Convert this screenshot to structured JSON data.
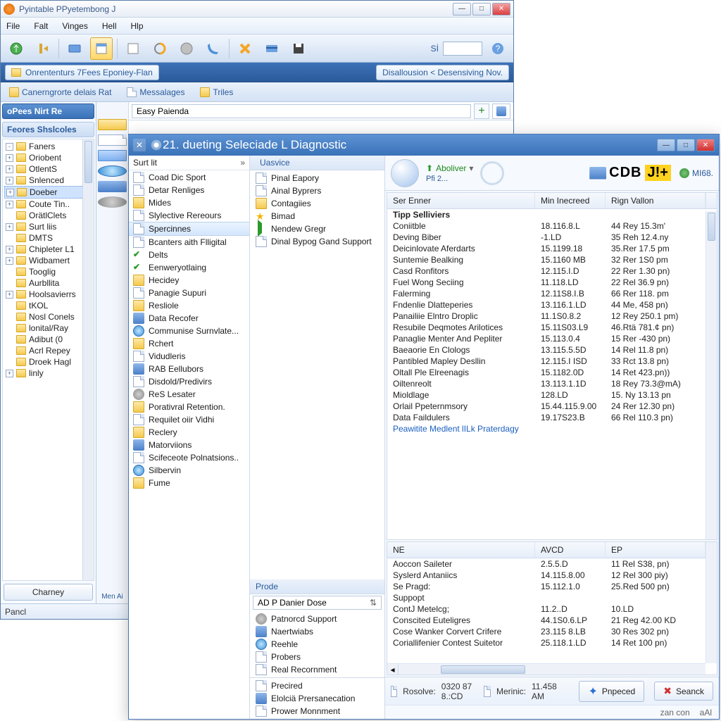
{
  "main": {
    "title": "Pyintable PPyetembong J",
    "menus": [
      "File",
      "Falt",
      "Vinges",
      "Hell",
      "Hlp"
    ],
    "breadcrumb": "Onrententurs 7Fees Eponiey-Flan",
    "infoRight": "Disallousion < Desensiving Nov.",
    "tabs": [
      "Canerngrorte delais Rat",
      "Messalages",
      "Triles"
    ],
    "locValue": "Easy Paienda",
    "sidebar": {
      "topLabel": "oPees Nirt Re",
      "header": "Feores Shslcoles",
      "items": [
        {
          "label": "Faners",
          "exp": "-"
        },
        {
          "label": "Oriobent",
          "exp": "+"
        },
        {
          "label": "OtlentS",
          "exp": "+"
        },
        {
          "label": "Snlenced",
          "exp": "+"
        },
        {
          "label": "Doeber",
          "exp": "+",
          "sel": true
        },
        {
          "label": "Coute Tin..",
          "exp": "+"
        },
        {
          "label": "OrätlClets",
          "exp": ""
        },
        {
          "label": "Surt liis",
          "exp": "+"
        },
        {
          "label": "DMTS",
          "exp": ""
        },
        {
          "label": "Chipleter L1",
          "exp": "+"
        },
        {
          "label": "Widbamert",
          "exp": "+"
        },
        {
          "label": "Tooglig",
          "exp": ""
        },
        {
          "label": "Aurbllita",
          "exp": ""
        },
        {
          "label": "Hoolsavierrs",
          "exp": "+"
        },
        {
          "label": "tKOL",
          "exp": ""
        },
        {
          "label": "Nosl Conels",
          "exp": ""
        },
        {
          "label": "lonital/Ray",
          "exp": ""
        },
        {
          "label": "Adibut (0",
          "exp": ""
        },
        {
          "label": "Acrl Repey",
          "exp": ""
        },
        {
          "label": "Droek Hagl",
          "exp": ""
        },
        {
          "label": "linly",
          "exp": "+"
        }
      ],
      "button": "Charney",
      "status": "Pancl"
    },
    "leftStrip": {
      "bottom": "Men Ai"
    }
  },
  "diag": {
    "title": "21. dueting Seleciade L Diagnostic",
    "sidebar": {
      "headLabel": "Surt lit",
      "items": [
        {
          "label": "Coad Dic Sport",
          "icon": "doc"
        },
        {
          "label": "Detar Renliges",
          "icon": "doc"
        },
        {
          "label": "Mides",
          "icon": "folder"
        },
        {
          "label": "Slylective Rereours",
          "icon": "doc"
        },
        {
          "label": "Spercinnes",
          "icon": "doc",
          "sel": true
        },
        {
          "label": "Bcanters aith Flligital",
          "icon": "doc"
        },
        {
          "label": "Delts",
          "icon": "check"
        },
        {
          "label": "Eenweryotlaing",
          "icon": "check"
        },
        {
          "label": "Hecidey",
          "icon": "folder"
        },
        {
          "label": "Panagie Supuri",
          "icon": "doc"
        },
        {
          "label": "Resliole",
          "icon": "folder"
        },
        {
          "label": "Data Recofer",
          "icon": "bluesq"
        },
        {
          "label": "Communise Surnvlate...",
          "icon": "globe"
        },
        {
          "label": "Rchert",
          "icon": "folder"
        },
        {
          "label": "Vidudleris",
          "icon": "doc"
        },
        {
          "label": "RAB Eellubors",
          "icon": "bluesq"
        },
        {
          "label": "Disdold/Predivirs",
          "icon": "doc"
        },
        {
          "label": "ReS Lesater",
          "icon": "gear"
        },
        {
          "label": "Porativral Retention.",
          "icon": "folder"
        },
        {
          "label": "Requilet oiir Vidhi",
          "icon": "doc"
        },
        {
          "label": "Reclery",
          "icon": "folder"
        },
        {
          "label": "Matorviions",
          "icon": "bluesq"
        },
        {
          "label": "Scifeceote Polnatsions..",
          "icon": "doc"
        },
        {
          "label": "Silbervin",
          "icon": "globe"
        },
        {
          "label": "Fume",
          "icon": "folder"
        }
      ]
    },
    "mid": {
      "topHead": "Uasvice",
      "topItems": [
        {
          "label": "Pinal Eapory",
          "icon": "doc"
        },
        {
          "label": "Ainal Byprers",
          "icon": "doc"
        },
        {
          "label": "Contagiies",
          "icon": "folder"
        },
        {
          "label": "Bimad",
          "icon": "star"
        },
        {
          "label": "Nendew Gregr",
          "icon": "arrow"
        },
        {
          "label": "Dinal Bypog Gand Support",
          "icon": "doc"
        }
      ],
      "prodeHead": "Prode",
      "dropLabel": "AD P Danier Dose",
      "prodeItems": [
        {
          "label": "Patnorcd Support",
          "icon": "gear"
        },
        {
          "label": "Naertwiabs",
          "icon": "bluesq"
        },
        {
          "label": "Reehle",
          "icon": "globe"
        },
        {
          "label": "Probers",
          "icon": "doc"
        },
        {
          "label": "Real Recornment",
          "icon": "doc"
        }
      ],
      "bottomItems": [
        {
          "label": "Precired",
          "icon": "doc"
        },
        {
          "label": "Elolciä Prersanecation",
          "icon": "bluesq"
        },
        {
          "label": "Prower Monnment",
          "icon": "doc"
        }
      ]
    },
    "toolbar": {
      "aboliver": "Aboliver",
      "pfi": "Pfi 2...",
      "brand": "CDB",
      "jplus": "J!+",
      "mi": "MI68."
    },
    "grid1": {
      "headers": [
        "Ser Enner",
        "Min Inecreed",
        "Rign Vallon"
      ],
      "rows": [
        {
          "c1": "Tipp Selliviers",
          "c2": "",
          "c3": "",
          "hdr": true
        },
        {
          "c1": "Coniitble",
          "c2": "18.116.8.L",
          "c3": "44 Rey 15.3m'"
        },
        {
          "c1": "Deving Biber",
          "c2": "-1.LD",
          "c3": "35 Reh 12.4.ny"
        },
        {
          "c1": "Deicinlovate Aferdarts",
          "c2": "15.1199.18",
          "c3": "35.Rer 17.5 pm"
        },
        {
          "c1": "Suntemie Bealking",
          "c2": "15.1160 MB",
          "c3": "32 Rer 1S0 pm"
        },
        {
          "c1": "Casd Ronfitors",
          "c2": "12.115.I.D",
          "c3": "22 Rer 1.30 pn)"
        },
        {
          "c1": "Fuel Wong Seciing",
          "c2": "11.118.LD",
          "c3": "22 Rel 36.9 pn)"
        },
        {
          "c1": "Falerming",
          "c2": "12.11S8.I.B",
          "c3": "66 Rer 118. pm"
        },
        {
          "c1": "Fndenlie Dlatteperies",
          "c2": "13.116.1.LD",
          "c3": "44 Me, 458 pn)"
        },
        {
          "c1": "Panailiie Elntro Droplic",
          "c2": "11.1S0.8.2",
          "c3": "12 Rey 250.1 pm)"
        },
        {
          "c1": "Resubile Deqmotes Arilotices",
          "c2": "15.11S03.L9",
          "c3": "46.Rtä 781.¢ pn)"
        },
        {
          "c1": "Panaglie Menter And Pepliter",
          "c2": "15.113.0.4",
          "c3": "15 Rer -430 pn)"
        },
        {
          "c1": "Baeaorie En Clologs",
          "c2": "13.115.5.5D",
          "c3": "14 Rel 11.8 pn)"
        },
        {
          "c1": "Pantibled Mapley Desllin",
          "c2": "12.115.I ISD",
          "c3": "33 Rct 13.8 pn)"
        },
        {
          "c1": "Oltall Ple Elreenagis",
          "c2": "15.1182.0D",
          "c3": "14 Ret 423.pn))"
        },
        {
          "c1": "Oiltenreolt",
          "c2": "13.113.1.1D",
          "c3": "18 Rey 73.3@mA)"
        },
        {
          "c1": "Mioldlage",
          "c2": "128.LD",
          "c3": "15. Ny 13.13 pn"
        },
        {
          "c1": "Orlail Ppeternmsory",
          "c2": "15.44.115.9.00",
          "c3": "24 Rer 12.30 pn)"
        },
        {
          "c1": "Data Faildulers",
          "c2": "19.17S23.B",
          "c3": "66 Rel 110.3 pn)"
        },
        {
          "c1": "Peawitite Medlent lILk Praterdagy",
          "c2": "",
          "c3": "",
          "link": true
        }
      ]
    },
    "grid2": {
      "headers": [
        "NE",
        "AVCD",
        "EP"
      ],
      "rows": [
        {
          "c1": "Aoccon Saileter",
          "c2": "2.5.5.D",
          "c3": "11 Rel S38, pn)"
        },
        {
          "c1": "Syslerd Antaniics",
          "c2": "14.115.8.00",
          "c3": "12 Rel 300 piy)"
        },
        {
          "c1": "Se Pragd:",
          "c2": "15.112.1.0",
          "c3": "25.Red 500 pn)"
        },
        {
          "c1": "Suppopt",
          "c2": "",
          "c3": ""
        },
        {
          "c1": "ContJ Metelcg;",
          "c2": "11.2..D",
          "c3": "10.LD"
        },
        {
          "c1": "Conscited Euteligres",
          "c2": "44.1S0.6.LP",
          "c3": "21 Reg 42.00 KD"
        },
        {
          "c1": "Cose Wanker Corvert Crifere",
          "c2": "23.115 8.LB",
          "c3": "30 Res 302 pn)"
        },
        {
          "c1": "Coriallifenier Contest Suitetor",
          "c2": "25.118.1.LD",
          "c3": "14 Ret 100 pn)"
        }
      ]
    },
    "footer": {
      "resolveLabel": "Rosolve:",
      "resolveVal": "0320 87 8.:CD",
      "menicLabel": "Merinic:",
      "menicVal": "11.458 AM",
      "btn1": "Pnpeced",
      "btn2": "Seanck"
    },
    "status": {
      "left": "zan con",
      "right": "aAl"
    }
  }
}
